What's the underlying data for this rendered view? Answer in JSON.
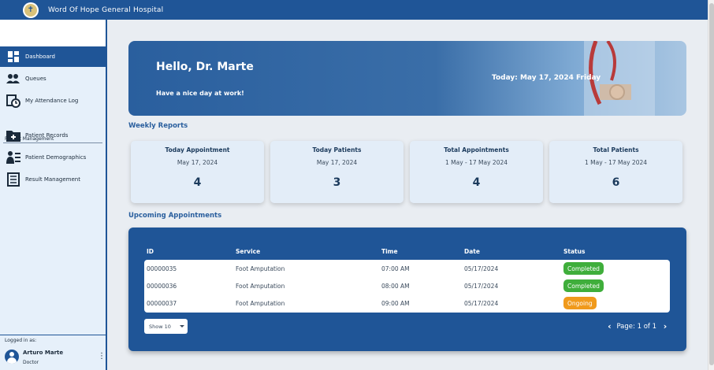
{
  "app": {
    "title": "Word Of Hope General Hospital"
  },
  "sidebar": {
    "items": [
      {
        "label": "Dashboard",
        "icon": "dashboard-icon",
        "active": true
      },
      {
        "label": "Queues",
        "icon": "people-queue-icon",
        "active": false
      },
      {
        "label": "My Attendance Log",
        "icon": "clock-log-icon",
        "active": false
      }
    ],
    "section": "Patient Management",
    "patient_items": [
      {
        "label": "Patient Records",
        "icon": "folder-plus-icon"
      },
      {
        "label": "Patient Demographics",
        "icon": "demographics-icon"
      },
      {
        "label": "Result Management",
        "icon": "document-list-icon"
      }
    ],
    "logged_in_label": "Logged in as:",
    "user": {
      "name": "Arturo Marte",
      "role": "Doctor"
    }
  },
  "hero": {
    "greeting": "Hello, Dr. Marte",
    "subtitle": "Have a nice day at work!",
    "today": "Today: May 17, 2024 Friday"
  },
  "weekly": {
    "title": "Weekly Reports",
    "cards": [
      {
        "title": "Today Appointment",
        "date": "May 17, 2024",
        "value": "4"
      },
      {
        "title": "Today Patients",
        "date": "May 17, 2024",
        "value": "3"
      },
      {
        "title": "Total Appointments",
        "date": "1 May - 17 May 2024",
        "value": "4"
      },
      {
        "title": "Total Patients",
        "date": "1 May - 17 May 2024",
        "value": "6"
      }
    ]
  },
  "appointments": {
    "title": "Upcoming Appointments",
    "columns": [
      "ID",
      "Service",
      "Time",
      "Date",
      "Status"
    ],
    "rows": [
      {
        "id": "00000035",
        "service": "Foot Amputation",
        "time": "07:00 AM",
        "date": "05/17/2024",
        "status": "Completed"
      },
      {
        "id": "00000036",
        "service": "Foot Amputation",
        "time": "08:00 AM",
        "date": "05/17/2024",
        "status": "Completed"
      },
      {
        "id": "00000037",
        "service": "Foot Amputation",
        "time": "09:00 AM",
        "date": "05/17/2024",
        "status": "Ongoing"
      }
    ],
    "show_select": "Show 10",
    "page_label": "Page: 1 of 1"
  },
  "colors": {
    "primary": "#1f5597",
    "completed": "#3fae3b",
    "ongoing": "#f09a1c",
    "card_bg": "#e3edf8"
  }
}
